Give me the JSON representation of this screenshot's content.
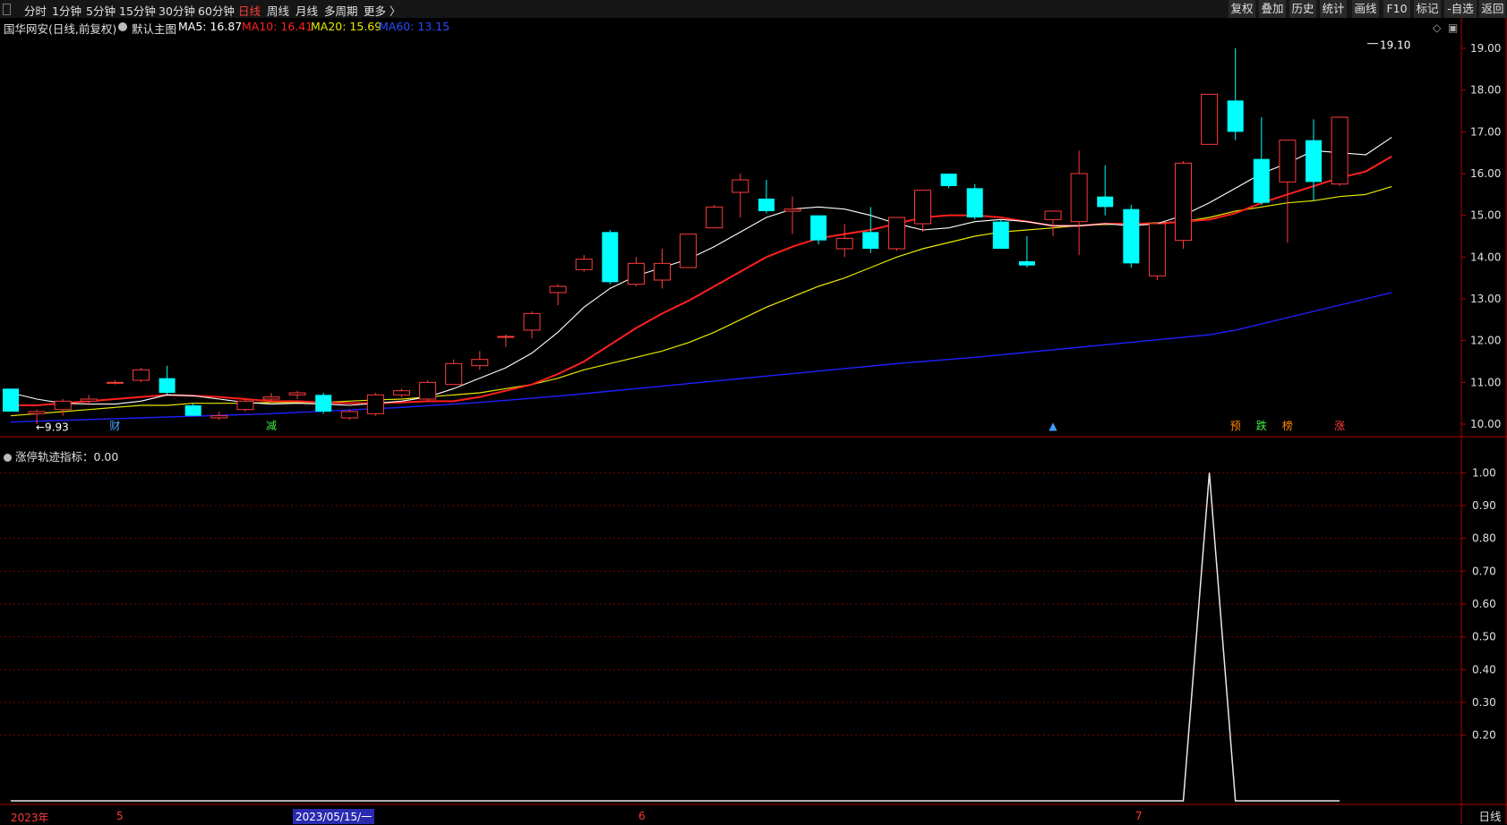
{
  "toolbar": {
    "periods": [
      "分时",
      "1分钟",
      "5分钟",
      "15分钟",
      "30分钟",
      "60分钟",
      "日线",
      "周线",
      "月线",
      "多周期",
      "更多 〉"
    ],
    "active_period": "日线",
    "right_buttons": [
      "复权",
      "叠加",
      "历史",
      "统计",
      "画线",
      "F10",
      "标记",
      "-自选",
      "返回"
    ]
  },
  "info": {
    "stock": "国华网安(日线,前复权)",
    "template": "默认主图",
    "ma5": "MA5: 16.87",
    "ma10": "MA10: 16.41",
    "ma20": "MA20: 15.69",
    "ma60": "MA60: 13.15"
  },
  "sub_chart": {
    "title": "涨停轨迹指标：0.00"
  },
  "colors": {
    "up": "#ff3b3b",
    "down": "#00ffff",
    "ma5": "#ffffff",
    "ma10": "#ff2020",
    "ma20": "#e8e800",
    "ma60": "#2020ff",
    "axis": "#b00000",
    "grid": "#7a0000"
  },
  "date_axis": {
    "year_label": "2023年",
    "month_labels": [
      "5",
      "6",
      "7"
    ],
    "selected_date": "2023/05/15/一",
    "mode_label": "日线"
  },
  "chart_data": [
    {
      "type": "candlestick",
      "title": "国华网安(日线,前复权)",
      "ylim": [
        9.7,
        19.3
      ],
      "y_ticks": [
        "19.00",
        "18.00",
        "17.00",
        "16.00",
        "15.00",
        "14.00",
        "13.00",
        "12.00",
        "11.00",
        "10.00"
      ],
      "candles": [
        {
          "o": 10.85,
          "h": 10.85,
          "l": 10.3,
          "c": 10.3
        },
        {
          "o": 10.25,
          "h": 10.35,
          "l": 10.0,
          "c": 10.3
        },
        {
          "o": 10.35,
          "h": 10.6,
          "l": 10.2,
          "c": 10.55
        },
        {
          "o": 10.55,
          "h": 10.7,
          "l": 10.45,
          "c": 10.6
        },
        {
          "o": 11.0,
          "h": 11.05,
          "l": 10.95,
          "c": 11.0
        },
        {
          "o": 11.05,
          "h": 11.35,
          "l": 11.0,
          "c": 11.3
        },
        {
          "o": 11.1,
          "h": 11.4,
          "l": 10.7,
          "c": 10.75
        },
        {
          "o": 10.45,
          "h": 10.5,
          "l": 10.2,
          "c": 10.2
        },
        {
          "o": 10.15,
          "h": 10.3,
          "l": 10.1,
          "c": 10.2
        },
        {
          "o": 10.35,
          "h": 10.6,
          "l": 10.3,
          "c": 10.55
        },
        {
          "o": 10.6,
          "h": 10.75,
          "l": 10.55,
          "c": 10.65
        },
        {
          "o": 10.7,
          "h": 10.8,
          "l": 10.6,
          "c": 10.75
        },
        {
          "o": 10.7,
          "h": 10.75,
          "l": 10.25,
          "c": 10.3
        },
        {
          "o": 10.15,
          "h": 10.35,
          "l": 10.1,
          "c": 10.3
        },
        {
          "o": 10.25,
          "h": 10.75,
          "l": 10.2,
          "c": 10.7
        },
        {
          "o": 10.7,
          "h": 10.85,
          "l": 10.65,
          "c": 10.8
        },
        {
          "o": 10.6,
          "h": 11.05,
          "l": 10.55,
          "c": 11.0
        },
        {
          "o": 10.95,
          "h": 11.55,
          "l": 10.95,
          "c": 11.45
        },
        {
          "o": 11.4,
          "h": 11.75,
          "l": 11.3,
          "c": 11.55
        },
        {
          "o": 12.1,
          "h": 12.15,
          "l": 11.85,
          "c": 12.1
        },
        {
          "o": 12.25,
          "h": 12.7,
          "l": 12.05,
          "c": 12.65
        },
        {
          "o": 13.15,
          "h": 13.35,
          "l": 12.85,
          "c": 13.3
        },
        {
          "o": 13.7,
          "h": 14.05,
          "l": 13.65,
          "c": 13.95
        },
        {
          "o": 14.6,
          "h": 14.65,
          "l": 13.35,
          "c": 13.4
        },
        {
          "o": 13.35,
          "h": 14.0,
          "l": 13.3,
          "c": 13.85
        },
        {
          "o": 13.45,
          "h": 14.2,
          "l": 13.25,
          "c": 13.85
        },
        {
          "o": 13.75,
          "h": 14.55,
          "l": 13.75,
          "c": 14.55
        },
        {
          "o": 14.7,
          "h": 15.25,
          "l": 14.7,
          "c": 15.2
        },
        {
          "o": 15.55,
          "h": 16.0,
          "l": 14.95,
          "c": 15.85
        },
        {
          "o": 15.4,
          "h": 15.85,
          "l": 15.05,
          "c": 15.1
        },
        {
          "o": 15.1,
          "h": 15.45,
          "l": 14.55,
          "c": 15.15
        },
        {
          "o": 15.0,
          "h": 15.0,
          "l": 14.3,
          "c": 14.4
        },
        {
          "o": 14.2,
          "h": 14.8,
          "l": 14.0,
          "c": 14.45
        },
        {
          "o": 14.6,
          "h": 15.2,
          "l": 14.1,
          "c": 14.2
        },
        {
          "o": 14.2,
          "h": 14.95,
          "l": 14.15,
          "c": 14.95
        },
        {
          "o": 14.8,
          "h": 15.5,
          "l": 14.6,
          "c": 15.6
        },
        {
          "o": 16.0,
          "h": 16.0,
          "l": 15.65,
          "c": 15.7
        },
        {
          "o": 15.65,
          "h": 15.75,
          "l": 14.9,
          "c": 14.95
        },
        {
          "o": 14.85,
          "h": 14.9,
          "l": 14.2,
          "c": 14.2
        },
        {
          "o": 13.9,
          "h": 14.5,
          "l": 13.75,
          "c": 13.8
        },
        {
          "o": 14.9,
          "h": 15.05,
          "l": 14.5,
          "c": 15.1
        },
        {
          "o": 14.85,
          "h": 16.55,
          "l": 14.05,
          "c": 16.0
        },
        {
          "o": 15.45,
          "h": 16.2,
          "l": 15.0,
          "c": 15.2
        },
        {
          "o": 15.15,
          "h": 15.25,
          "l": 13.75,
          "c": 13.85
        },
        {
          "o": 13.55,
          "h": 14.8,
          "l": 13.45,
          "c": 14.8
        },
        {
          "o": 14.4,
          "h": 16.3,
          "l": 14.2,
          "c": 16.25
        },
        {
          "o": 16.7,
          "h": 17.9,
          "l": 16.7,
          "c": 17.9
        },
        {
          "o": 17.75,
          "h": 19.0,
          "l": 16.8,
          "c": 17.0
        },
        {
          "o": 16.35,
          "h": 17.35,
          "l": 15.25,
          "c": 15.3
        },
        {
          "o": 15.8,
          "h": 16.8,
          "l": 14.35,
          "c": 16.8
        },
        {
          "o": 16.8,
          "h": 17.3,
          "l": 15.35,
          "c": 15.8
        },
        {
          "o": 15.75,
          "h": 17.35,
          "l": 15.7,
          "c": 17.35
        }
      ],
      "ma5": [
        10.75,
        10.6,
        10.5,
        10.48,
        10.48,
        10.55,
        10.7,
        10.68,
        10.6,
        10.52,
        10.48,
        10.5,
        10.48,
        10.45,
        10.5,
        10.55,
        10.65,
        10.85,
        11.1,
        11.35,
        11.7,
        12.2,
        12.8,
        13.25,
        13.55,
        13.75,
        13.95,
        14.25,
        14.6,
        14.95,
        15.15,
        15.2,
        15.15,
        15.0,
        14.8,
        14.65,
        14.7,
        14.85,
        14.9,
        14.85,
        14.75,
        14.75,
        14.8,
        14.75,
        14.8,
        15.0,
        15.3,
        15.65,
        16.0,
        16.25,
        16.55,
        16.5,
        16.45,
        16.87
      ],
      "ma10": [
        10.45,
        10.45,
        10.5,
        10.55,
        10.6,
        10.65,
        10.7,
        10.68,
        10.65,
        10.6,
        10.55,
        10.55,
        10.52,
        10.5,
        10.5,
        10.52,
        10.55,
        10.55,
        10.65,
        10.8,
        10.95,
        11.2,
        11.5,
        11.9,
        12.3,
        12.65,
        12.95,
        13.3,
        13.65,
        14.0,
        14.25,
        14.45,
        14.55,
        14.65,
        14.8,
        14.95,
        15.0,
        15.0,
        14.95,
        14.85,
        14.75,
        14.75,
        14.8,
        14.8,
        14.8,
        14.85,
        14.9,
        15.05,
        15.3,
        15.5,
        15.7,
        15.9,
        16.05,
        16.41
      ],
      "ma20": [
        10.2,
        10.25,
        10.3,
        10.35,
        10.4,
        10.45,
        10.45,
        10.5,
        10.5,
        10.5,
        10.52,
        10.52,
        10.52,
        10.55,
        10.58,
        10.6,
        10.65,
        10.7,
        10.75,
        10.85,
        10.95,
        11.1,
        11.3,
        11.45,
        11.6,
        11.75,
        11.95,
        12.2,
        12.5,
        12.8,
        13.05,
        13.3,
        13.5,
        13.75,
        14.0,
        14.2,
        14.35,
        14.5,
        14.6,
        14.65,
        14.7,
        14.75,
        14.78,
        14.8,
        14.82,
        14.85,
        14.95,
        15.1,
        15.2,
        15.3,
        15.35,
        15.45,
        15.5,
        15.69
      ],
      "ma60": [
        10.05,
        10.07,
        10.09,
        10.11,
        10.13,
        10.15,
        10.17,
        10.19,
        10.21,
        10.23,
        10.25,
        10.28,
        10.31,
        10.34,
        10.37,
        10.4,
        10.44,
        10.48,
        10.52,
        10.57,
        10.62,
        10.67,
        10.73,
        10.79,
        10.85,
        10.91,
        10.97,
        11.03,
        11.09,
        11.15,
        11.21,
        11.27,
        11.33,
        11.39,
        11.45,
        11.5,
        11.55,
        11.6,
        11.66,
        11.72,
        11.78,
        11.84,
        11.9,
        11.96,
        12.02,
        12.08,
        12.14,
        12.25,
        12.4,
        12.55,
        12.7,
        12.85,
        13.0,
        13.15
      ],
      "markers": [
        {
          "x": 4,
          "text": "财",
          "color": "#4aa8ff"
        },
        {
          "x": 10,
          "text": "减",
          "color": "#44ee44"
        },
        {
          "x": 40,
          "text": "▲",
          "color": "#3fa0ff"
        },
        {
          "x": 47,
          "text": "预",
          "color": "#ff8a00"
        },
        {
          "x": 48,
          "text": "跌",
          "color": "#44ee44"
        },
        {
          "x": 49,
          "text": "榜",
          "color": "#ff8a00"
        },
        {
          "x": 51,
          "text": "涨",
          "color": "#ff3b3b"
        }
      ],
      "price_labels": {
        "high": "19.10",
        "low": "9.93"
      }
    },
    {
      "type": "line",
      "title": "涨停轨迹指标",
      "ylim": [
        0,
        1.05
      ],
      "y_ticks": [
        "1.00",
        "0.90",
        "0.80",
        "0.70",
        "0.60",
        "0.50",
        "0.40",
        "0.30",
        "0.20"
      ],
      "values": [
        0,
        0,
        0,
        0,
        0,
        0,
        0,
        0,
        0,
        0,
        0,
        0,
        0,
        0,
        0,
        0,
        0,
        0,
        0,
        0,
        0,
        0,
        0,
        0,
        0,
        0,
        0,
        0,
        0,
        0,
        0,
        0,
        0,
        0,
        0,
        0,
        0,
        0,
        0,
        0,
        0,
        0,
        0,
        0,
        0,
        0,
        1,
        0,
        0,
        0,
        0,
        0
      ]
    }
  ]
}
